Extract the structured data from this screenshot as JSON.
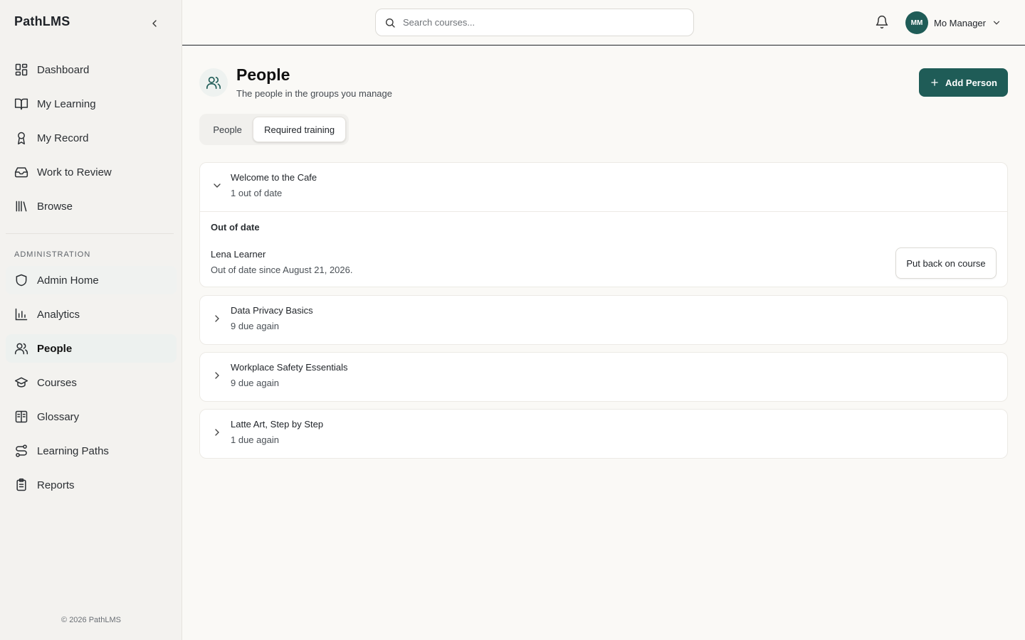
{
  "app": {
    "brand": "PathLMS",
    "footer": "© 2026 PathLMS"
  },
  "sidebar": {
    "main_items": [
      {
        "label": "Dashboard",
        "icon": "dashboard-icon"
      },
      {
        "label": "My Learning",
        "icon": "book-open-icon"
      },
      {
        "label": "My Record",
        "icon": "award-icon"
      },
      {
        "label": "Work to Review",
        "icon": "inbox-icon"
      },
      {
        "label": "Browse",
        "icon": "library-icon"
      }
    ],
    "section_label": "ADMINISTRATION",
    "admin_items": [
      {
        "label": "Admin Home",
        "icon": "shield-icon"
      },
      {
        "label": "Analytics",
        "icon": "bar-chart-icon"
      },
      {
        "label": "People",
        "icon": "users-icon",
        "active": true
      },
      {
        "label": "Courses",
        "icon": "graduation-cap-icon"
      },
      {
        "label": "Glossary",
        "icon": "book-glossary-icon"
      },
      {
        "label": "Learning Paths",
        "icon": "route-icon"
      },
      {
        "label": "Reports",
        "icon": "clipboard-icon"
      }
    ]
  },
  "header": {
    "search_placeholder": "Search courses...",
    "user_initials": "MM",
    "user_name": "Mo Manager"
  },
  "page": {
    "title": "People",
    "subtitle": "The people in the groups you manage",
    "add_button": "Add Person",
    "tabs": [
      {
        "label": "People",
        "selected": false
      },
      {
        "label": "Required training",
        "selected": true
      }
    ]
  },
  "trainings": [
    {
      "title": "Welcome to the Cafe",
      "meta": "1 out of date",
      "expanded": true,
      "group_label": "Out of date",
      "person": {
        "name": "Lena Learner",
        "meta": "Out of date since August 21, 2026.",
        "action": "Put back on course"
      }
    },
    {
      "title": "Data Privacy Basics",
      "meta": "9 due again",
      "expanded": false
    },
    {
      "title": "Workplace Safety Essentials",
      "meta": "9 due again",
      "expanded": false
    },
    {
      "title": "Latte Art, Step by Step",
      "meta": "1 due again",
      "expanded": false
    }
  ],
  "colors": {
    "accent": "#1f5c57",
    "background": "#faf9f6",
    "sidebar": "#f3f2ef"
  }
}
